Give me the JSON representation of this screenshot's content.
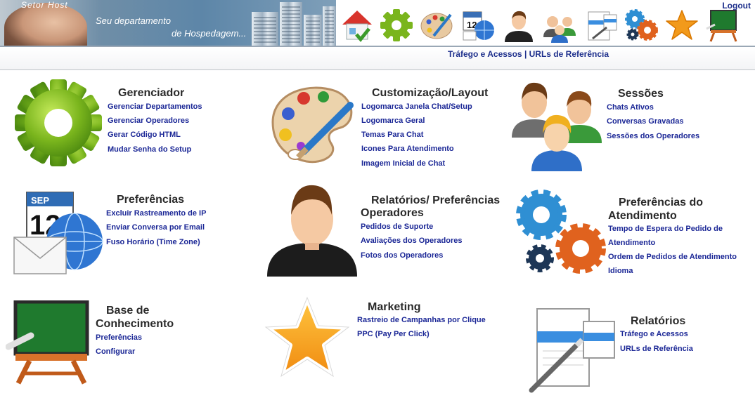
{
  "header": {
    "brand": "Setor Host",
    "slogan_line1": "Seu departamento",
    "slogan_line2": "de Hospedagem...",
    "logout": "Logout",
    "toolbar_icons": [
      "home-check-icon",
      "gear-icon",
      "palette-icon",
      "calendar-globe-icon",
      "operator-icon",
      "users-icon",
      "report-icon",
      "gears-icon",
      "star-icon",
      "chalkboard-icon"
    ]
  },
  "subbar": {
    "link1": "Tráfego e Acessos",
    "separator": " | ",
    "link2": "URLs de Referência"
  },
  "sections": {
    "gerenciador": {
      "title": "Gerenciador",
      "links": [
        "Gerenciar Departamentos",
        "Gerenciar Operadores",
        "Gerar Código HTML",
        "Mudar Senha do Setup"
      ]
    },
    "customizacao": {
      "title": "Customização/Layout",
      "links": [
        "Logomarca Janela Chat/Setup",
        "Logomarca Geral",
        "Temas Para Chat",
        "Icones Para Atendimento",
        "Imagem Inicial de Chat"
      ]
    },
    "sessoes": {
      "title": "Sessões",
      "links": [
        "Chats Ativos",
        "Conversas Gravadas",
        "Sessões dos Operadores"
      ]
    },
    "preferencias": {
      "title": "Preferências",
      "links": [
        "Excluir Rastreamento de IP",
        "Enviar Conversa por Email",
        "Fuso Horário (Time Zone)"
      ]
    },
    "relatorios_operadores": {
      "title_line1": "Relatórios/ Preferências",
      "title_line2": "Operadores",
      "links": [
        "Pedidos de Suporte",
        "Avaliações dos Operadores",
        "Fotos dos Operadores"
      ]
    },
    "pref_atendimento": {
      "title_line1": "Preferências do",
      "title_line2": "Atendimento",
      "links": [
        "Tempo de Espera do Pedido de",
        "Atendimento",
        "Ordem de Pedidos de Atendimento",
        "Idioma"
      ]
    },
    "base_conhecimento": {
      "title_line1": "Base de",
      "title_line2": "Conhecimento",
      "links": [
        "Preferências",
        "Configurar"
      ]
    },
    "marketing": {
      "title": "Marketing",
      "links": [
        "Rastreio de Campanhas por Clique",
        "PPC (Pay Per Click)"
      ]
    },
    "relatorios": {
      "title": "Relatórios",
      "links": [
        "Tráfego e Acessos",
        "URLs de Referência"
      ]
    }
  },
  "calendar": {
    "month": "SEP",
    "day": "12"
  },
  "colors": {
    "link": "#1b2796",
    "title": "#2a2a2a",
    "gear_green": "#7ab51d",
    "gear_blue": "#2f8fd3",
    "gear_orange": "#e0621e",
    "star_orange": "#f29a1b",
    "board_green": "#1f7a2e"
  }
}
